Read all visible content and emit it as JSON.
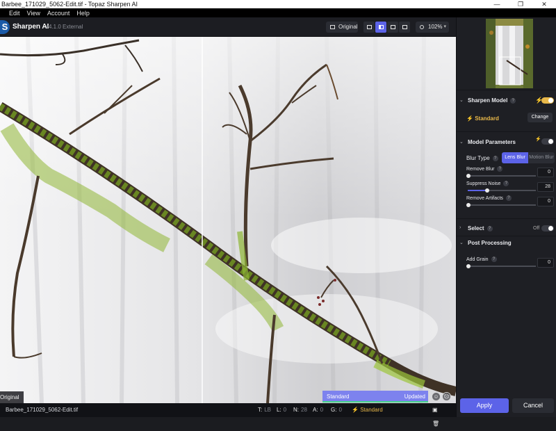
{
  "window": {
    "title": "Barbee_171029_5062-Edit.tif - Topaz Sharpen AI",
    "controls": [
      "—",
      "❐",
      "✕"
    ]
  },
  "menu": [
    "",
    "Edit",
    "View",
    "Account",
    "Help"
  ],
  "app": {
    "logo_letter": "S",
    "name": "Sharpen AI",
    "version": "v4.1.0 External"
  },
  "toolbar": {
    "original_label": "Original",
    "zoom_label": "102%"
  },
  "canvas": {
    "original_tag": "Original",
    "preview_model": "Standard",
    "preview_status": "Updated"
  },
  "statusbar": {
    "filename": "Barbee_171029_5062-Edit.tif",
    "stats": [
      {
        "key": "T:",
        "value": "LB"
      },
      {
        "key": "L:",
        "value": "0"
      },
      {
        "key": "N:",
        "value": "28"
      },
      {
        "key": "A:",
        "value": "0"
      },
      {
        "key": "G:",
        "value": "0"
      }
    ],
    "model": "Standard"
  },
  "sidebar": {
    "sharpen_model": {
      "label": "Sharpen Model",
      "model_name": "Standard",
      "change_label": "Change",
      "enabled": true
    },
    "model_parameters": {
      "label": "Model Parameters",
      "blur_type_label": "Blur Type",
      "blur_options": [
        "Lens Blur",
        "Motion Blur"
      ],
      "blur_selected": "Lens Blur",
      "sliders": [
        {
          "label": "Remove Blur",
          "value": "0",
          "level": 0.0
        },
        {
          "label": "Suppress Noise",
          "value": "28",
          "level": 0.28
        },
        {
          "label": "Remove Artifacts",
          "value": "0",
          "level": 0.0
        }
      ]
    },
    "select": {
      "label": "Select",
      "state_label": "Off"
    },
    "post_processing": {
      "label": "Post Processing",
      "sliders": [
        {
          "label": "Add Grain",
          "value": "0",
          "level": 0.0
        }
      ]
    },
    "apply_label": "Apply",
    "cancel_label": "Cancel"
  },
  "colors": {
    "accent": "#5c63e8",
    "warning": "#e8b84a",
    "progress": "#46d28c"
  }
}
